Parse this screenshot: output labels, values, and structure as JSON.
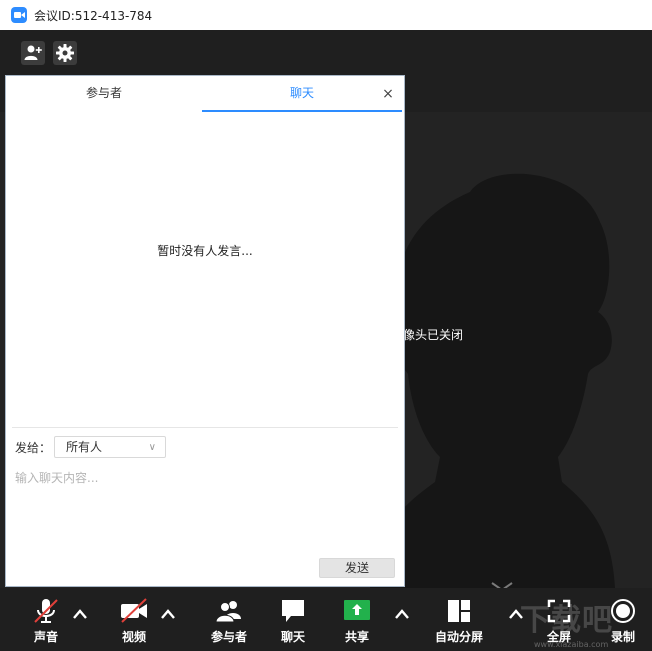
{
  "window": {
    "title": "会议ID:512-413-784"
  },
  "top_toolbar": {
    "invite_icon": "add-user-icon",
    "settings_icon": "gear-icon"
  },
  "video": {
    "camera_status": "像头已关闭"
  },
  "chat_panel": {
    "tabs": [
      {
        "label": "参与者"
      },
      {
        "label": "聊天"
      }
    ],
    "active_tab": "聊天",
    "close_label": "×",
    "empty_message": "暂时没有人发言...",
    "send_to_label": "发给：",
    "recipient": "所有人",
    "input_placeholder": "输入聊天内容...",
    "send_label": "发送"
  },
  "toolbar": {
    "audio_label": "声音",
    "video_label": "视频",
    "participants_label": "参与者",
    "chat_label": "聊天",
    "share_label": "共享",
    "layout_label": "自动分屏",
    "fullscreen_label": "全屏",
    "record_label": "录制"
  },
  "colors": {
    "accent": "#2d8cff",
    "share": "#22b14c",
    "muted": "#e0403a"
  },
  "watermark": "下载吧",
  "watermark_url": "www.xiazaiba.com"
}
